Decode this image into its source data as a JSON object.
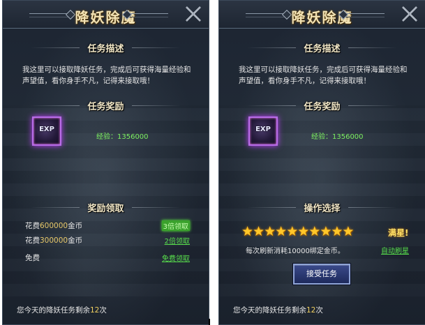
{
  "panels": {
    "left": {
      "title": "降妖除魔",
      "description_header": "任务描述",
      "description": "我这里可以接取降妖任务，完成后可获得海量经验和声望值，看你身手不凡，记得来接取哦！",
      "reward_header": "任务奖励",
      "reward_icon_label": "EXP",
      "reward_value": "经验：1356000",
      "claim_header": "奖励领取",
      "claim_rows": [
        {
          "cost_prefix": "花费",
          "amount": "600000",
          "cost_suffix": "金币",
          "action": "3倍领取"
        },
        {
          "cost_prefix": "花费",
          "amount": "300000",
          "cost_suffix": "金币",
          "action": "2倍领取"
        },
        {
          "cost_prefix": "免费",
          "amount": "",
          "cost_suffix": "",
          "action": "免费领取"
        }
      ],
      "footer_prefix": "您今天的降妖任务剩余",
      "footer_count": "12",
      "footer_suffix": "次"
    },
    "right": {
      "title": "降妖除魔",
      "description_header": "任务描述",
      "description": "我这里可以接取降妖任务，完成后可获得海量经验和声望值，看你身手不凡，记得来接取哦！",
      "reward_header": "任务奖励",
      "reward_icon_label": "EXP",
      "reward_value": "经验：1356000",
      "operation_header": "操作选择",
      "star_count": 10,
      "full_star_label": "满星!",
      "refresh_info": "每次刷新消耗10000绑定金币。",
      "refresh_action": "自动刷星",
      "accept_button": "接受任务",
      "footer_prefix": "您今天的降妖任务剩余",
      "footer_count": "12",
      "footer_suffix": "次"
    }
  },
  "colors": {
    "title": "#f3e3b5",
    "reward_green": "#7cf060",
    "link_green": "#58e04c",
    "gold": "#f0d060",
    "star": "#ffc72a",
    "exp_glow": "#c040ff"
  },
  "icons": {
    "close": "close-icon",
    "exp": "exp-scroll-icon",
    "star": "star-icon"
  }
}
